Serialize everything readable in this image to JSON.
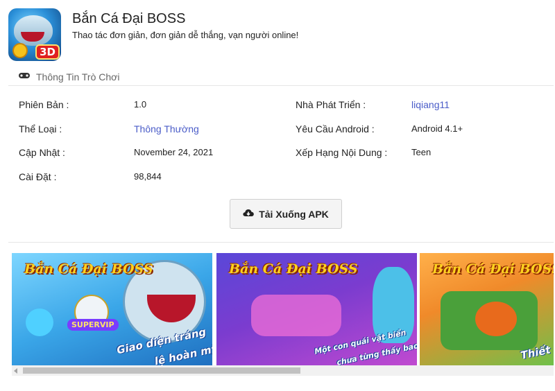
{
  "app": {
    "title": "Bắn Cá Đại BOSS",
    "subtitle": "Thao tác đơn giản, đơn giản dễ thắng, vạn người online!",
    "icon_badge": "3D"
  },
  "section": {
    "title": "Thông Tin Trò Chơi",
    "icon": "gamepad-icon"
  },
  "info": {
    "version_label": "Phiên Bản :",
    "version_value": "1.0",
    "category_label": "Thể Loại :",
    "category_value": "Thông Thường",
    "updated_label": "Cập Nhật :",
    "updated_value": "November 24, 2021",
    "installs_label": "Cài Đặt :",
    "installs_value": "98,844",
    "developer_label": "Nhà Phát Triển :",
    "developer_value": "liqiang11",
    "android_label": "Yêu Cầu Android :",
    "android_value": "Android 4.1+",
    "rating_label": "Xếp Hạng Nội Dung :",
    "rating_value": "Teen"
  },
  "download": {
    "label": "Tải Xuống APK",
    "icon": "cloud-download-icon"
  },
  "screenshots": [
    {
      "logo": "Bắn Cá Đại BOSS",
      "caption": "Giao diện tráng",
      "caption2": "lệ hoàn mỹ",
      "badge": "SUPERVIP"
    },
    {
      "logo": "Bắn Cá Đại BOSS",
      "caption": "Một con quái vật biển",
      "caption2": "chưa từng thấy bao giờ"
    },
    {
      "logo": "Bắn Cá Đại BOSS",
      "caption": "Thiết kế"
    }
  ],
  "colors": {
    "link": "#4a5cc8",
    "divider": "#e6e6e6",
    "button_bg": "#f4f4f4"
  }
}
